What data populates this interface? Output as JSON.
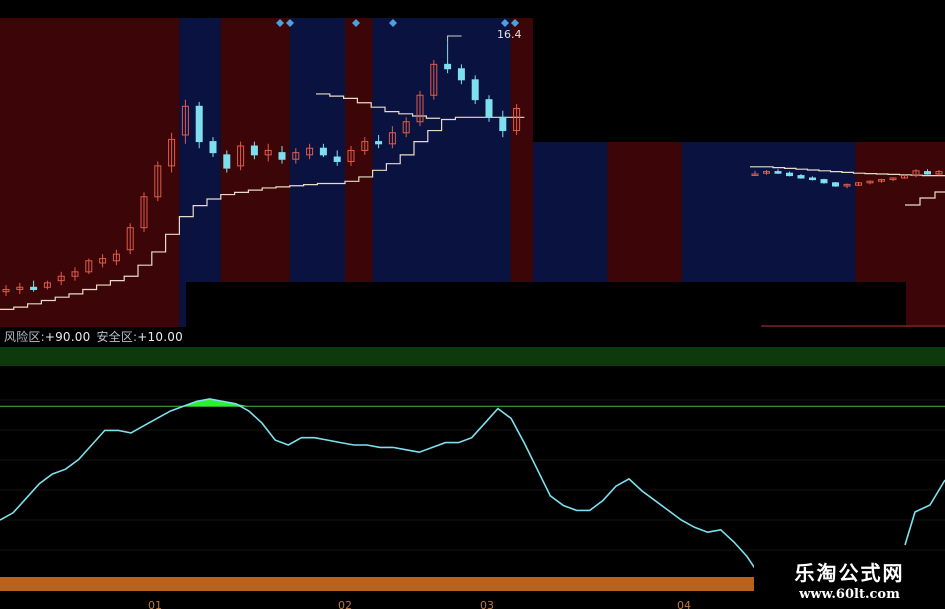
{
  "chart_data": [
    {
      "type": "candlestick",
      "peak_label": "16.4",
      "price_range": [
        3.5,
        17.5
      ],
      "zone_colors": {
        "risk": "#3c0608",
        "safe": "#0a1240"
      },
      "zones": [
        [
          "risk",
          0,
          13
        ],
        [
          "safe",
          13,
          16
        ],
        [
          "risk",
          16,
          21
        ],
        [
          "safe",
          21,
          25
        ],
        [
          "risk",
          25,
          27
        ],
        [
          "safe",
          27,
          37
        ],
        [
          "risk",
          37,
          39
        ]
      ],
      "up_color": "#e05a4a",
      "down_color": "#7ee0ee",
      "candles": [
        {
          "o": 5.1,
          "h": 5.4,
          "l": 4.9,
          "c": 5.2
        },
        {
          "o": 5.2,
          "h": 5.5,
          "l": 5.0,
          "c": 5.3
        },
        {
          "o": 5.3,
          "h": 5.6,
          "l": 5.1,
          "c": 5.2
        },
        {
          "o": 5.3,
          "h": 5.6,
          "l": 5.2,
          "c": 5.5
        },
        {
          "o": 5.6,
          "h": 6.0,
          "l": 5.4,
          "c": 5.8
        },
        {
          "o": 5.8,
          "h": 6.2,
          "l": 5.6,
          "c": 6.0
        },
        {
          "o": 6.0,
          "h": 6.6,
          "l": 5.9,
          "c": 6.5
        },
        {
          "o": 6.4,
          "h": 6.8,
          "l": 6.2,
          "c": 6.6
        },
        {
          "o": 6.5,
          "h": 7.0,
          "l": 6.3,
          "c": 6.8
        },
        {
          "o": 7.0,
          "h": 8.2,
          "l": 6.8,
          "c": 8.0
        },
        {
          "o": 8.0,
          "h": 9.6,
          "l": 7.8,
          "c": 9.4
        },
        {
          "o": 9.4,
          "h": 11.0,
          "l": 9.2,
          "c": 10.8
        },
        {
          "o": 10.8,
          "h": 12.3,
          "l": 10.5,
          "c": 12.0
        },
        {
          "o": 12.2,
          "h": 13.8,
          "l": 11.8,
          "c": 13.5
        },
        {
          "o": 13.5,
          "h": 13.7,
          "l": 11.6,
          "c": 11.9
        },
        {
          "o": 11.9,
          "h": 12.1,
          "l": 11.2,
          "c": 11.4
        },
        {
          "o": 11.3,
          "h": 11.5,
          "l": 10.5,
          "c": 10.7
        },
        {
          "o": 10.8,
          "h": 11.9,
          "l": 10.6,
          "c": 11.7
        },
        {
          "o": 11.7,
          "h": 11.9,
          "l": 11.1,
          "c": 11.3
        },
        {
          "o": 11.3,
          "h": 11.8,
          "l": 11.0,
          "c": 11.5
        },
        {
          "o": 11.4,
          "h": 11.7,
          "l": 10.9,
          "c": 11.1
        },
        {
          "o": 11.1,
          "h": 11.6,
          "l": 10.9,
          "c": 11.4
        },
        {
          "o": 11.3,
          "h": 11.8,
          "l": 11.1,
          "c": 11.6
        },
        {
          "o": 11.6,
          "h": 11.8,
          "l": 11.2,
          "c": 11.3
        },
        {
          "o": 11.2,
          "h": 11.5,
          "l": 10.8,
          "c": 11.0
        },
        {
          "o": 11.0,
          "h": 11.7,
          "l": 10.8,
          "c": 11.5
        },
        {
          "o": 11.5,
          "h": 12.1,
          "l": 11.3,
          "c": 11.9
        },
        {
          "o": 11.9,
          "h": 12.2,
          "l": 11.6,
          "c": 11.8
        },
        {
          "o": 11.8,
          "h": 12.6,
          "l": 11.6,
          "c": 12.3
        },
        {
          "o": 12.3,
          "h": 13.0,
          "l": 12.1,
          "c": 12.8
        },
        {
          "o": 12.8,
          "h": 14.2,
          "l": 12.6,
          "c": 14.0
        },
        {
          "o": 14.0,
          "h": 15.6,
          "l": 13.8,
          "c": 15.4
        },
        {
          "o": 15.4,
          "h": 16.4,
          "l": 15.0,
          "c": 15.2
        },
        {
          "o": 15.2,
          "h": 15.4,
          "l": 14.5,
          "c": 14.7
        },
        {
          "o": 14.7,
          "h": 14.9,
          "l": 13.6,
          "c": 13.8
        },
        {
          "o": 13.8,
          "h": 14.0,
          "l": 12.8,
          "c": 13.0
        },
        {
          "o": 13.0,
          "h": 13.3,
          "l": 12.1,
          "c": 12.4
        },
        {
          "o": 12.4,
          "h": 13.6,
          "l": 12.2,
          "c": 13.4
        }
      ],
      "stair_line": {
        "color": "#e8dcc8",
        "values": [
          4.3,
          4.4,
          4.55,
          4.7,
          4.85,
          5.0,
          5.2,
          5.4,
          5.6,
          5.8,
          6.3,
          6.9,
          7.7,
          8.5,
          9.0,
          9.3,
          9.5,
          9.6,
          9.7,
          9.8,
          9.85,
          9.9,
          9.95,
          10.0,
          10.0,
          10.1,
          10.3,
          10.6,
          10.9,
          11.3,
          11.9,
          12.4,
          12.9,
          13.0,
          13.0,
          13.0,
          13.0,
          13.0
        ]
      },
      "upper_step_line": {
        "color": "#e8dcc8",
        "values": [
          12.7,
          12.6,
          12.5,
          12.3,
          12.1,
          11.9,
          11.8,
          11.7,
          11.6
        ]
      }
    },
    {
      "type": "candlestick",
      "panel": "right-upper",
      "price_range": [
        0,
        10
      ],
      "zones": [
        [
          "safe",
          0,
          3
        ],
        [
          "risk",
          3,
          6
        ],
        [
          "safe",
          6,
          13
        ],
        [
          "risk",
          13,
          17
        ]
      ],
      "candles": [
        {
          "o": 7.0,
          "h": 7.4,
          "l": 6.8,
          "c": 7.0
        },
        {
          "o": 7.1,
          "h": 7.5,
          "l": 6.9,
          "c": 7.3
        },
        {
          "o": 7.3,
          "h": 7.6,
          "l": 7.0,
          "c": 7.1
        },
        {
          "o": 7.1,
          "h": 7.3,
          "l": 6.7,
          "c": 6.8
        },
        {
          "o": 6.8,
          "h": 7.0,
          "l": 6.4,
          "c": 6.5
        },
        {
          "o": 6.5,
          "h": 6.7,
          "l": 6.2,
          "c": 6.3
        },
        {
          "o": 6.3,
          "h": 6.4,
          "l": 5.8,
          "c": 5.9
        },
        {
          "o": 5.9,
          "h": 6.0,
          "l": 5.4,
          "c": 5.5
        },
        {
          "o": 5.5,
          "h": 5.8,
          "l": 5.2,
          "c": 5.7
        },
        {
          "o": 5.6,
          "h": 6.0,
          "l": 5.5,
          "c": 5.9
        },
        {
          "o": 5.9,
          "h": 6.2,
          "l": 5.7,
          "c": 6.1
        },
        {
          "o": 6.1,
          "h": 6.4,
          "l": 5.9,
          "c": 6.3
        },
        {
          "o": 6.3,
          "h": 6.6,
          "l": 6.1,
          "c": 6.5
        },
        {
          "o": 6.5,
          "h": 6.9,
          "l": 6.4,
          "c": 6.8
        },
        {
          "o": 6.8,
          "h": 7.6,
          "l": 6.6,
          "c": 7.4
        },
        {
          "o": 7.3,
          "h": 7.6,
          "l": 6.9,
          "c": 7.0
        },
        {
          "o": 7.0,
          "h": 7.5,
          "l": 6.8,
          "c": 7.3
        }
      ],
      "step_line": {
        "color": "#e8dcc8",
        "values": [
          7.4,
          7.4,
          7.3,
          7.2,
          7.1,
          7.0,
          6.9,
          6.8,
          6.7,
          6.6,
          6.55,
          6.5,
          6.45,
          6.4,
          6.35,
          6.3,
          6.3
        ]
      }
    },
    {
      "type": "area",
      "label_risk": "风险区:",
      "risk_value": "+90.00",
      "label_safe": "安全区:",
      "safe_value": "+10.00",
      "threshold": 90,
      "ylim": [
        10,
        100
      ],
      "line_color": "#7ee0ee",
      "fill_color": "#2df02d",
      "values": [
        43,
        46,
        52,
        58,
        62,
        64,
        68,
        74,
        80,
        80,
        79,
        82,
        85,
        88,
        90,
        92,
        93,
        92,
        91,
        88,
        83,
        76,
        74,
        77,
        77,
        76,
        75,
        74,
        74,
        73,
        73,
        72,
        71,
        73,
        75,
        75,
        77,
        83,
        89,
        85,
        75,
        64,
        53,
        49,
        47,
        47,
        51,
        57,
        60,
        55,
        51,
        47,
        43,
        40,
        38,
        39,
        34,
        28,
        20
      ],
      "x_ticks": [
        "01",
        "02",
        "03",
        "04"
      ]
    }
  ],
  "diamonds": {
    "color": "#4f9fe0"
  },
  "watermark": {
    "title": "乐淘公式网",
    "url": "www.60lt.com"
  }
}
